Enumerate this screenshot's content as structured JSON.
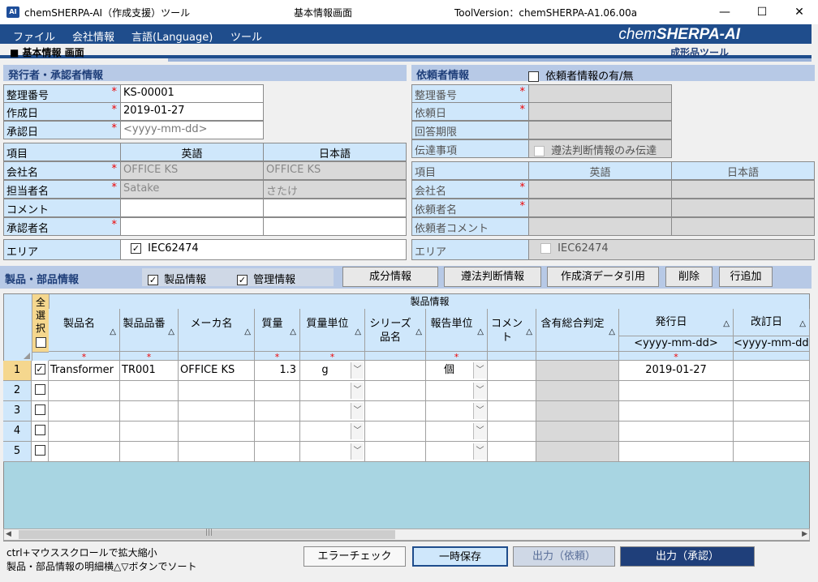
{
  "window": {
    "title": "chemSHERPA-AI（作成支援）ツール",
    "screen_title": "基本情報画面",
    "tool_version": "ToolVersion：chemSHERPA-A1.06.00a",
    "app_icon": "AI"
  },
  "menu": {
    "items": [
      "ファイル",
      "会社情報",
      "言語(Language)",
      "ツール"
    ],
    "logo_prefix": "chem",
    "logo_main": "SHERPA",
    "logo_suffix": "-AI"
  },
  "screen_header": {
    "label": "■ 基本情報 画面",
    "product_tool": "成形品ツール"
  },
  "issuer": {
    "section_title": "発行者・承認者情報",
    "rows": [
      {
        "label": "整理番号",
        "value": "KS-00001"
      },
      {
        "label": "作成日",
        "value": "2019-01-27"
      },
      {
        "label": "承認日",
        "value": "<yyyy-mm-dd>"
      }
    ],
    "table_header": {
      "item": "項目",
      "english": "英語",
      "japanese": "日本語"
    },
    "table_rows": [
      {
        "label": "会社名",
        "required": true,
        "english": "OFFICE KS",
        "japanese": "OFFICE KS"
      },
      {
        "label": "担当者名",
        "required": true,
        "english": "Satake",
        "japanese": "さたけ"
      },
      {
        "label": "コメント",
        "required": false,
        "english": "",
        "japanese": ""
      },
      {
        "label": "承認者名",
        "required": true,
        "english": "",
        "japanese": ""
      }
    ],
    "area_label": "エリア",
    "area_value": "IEC62474",
    "required_mark": "*",
    "check_mark": "✓"
  },
  "requester": {
    "section_title": "依頼者情報",
    "toggle_label": "依頼者情報の有/無",
    "rows": [
      {
        "label": "整理番号",
        "required": true
      },
      {
        "label": "依頼日",
        "required": true
      },
      {
        "label": "回答期限",
        "required": false
      }
    ],
    "transmit_label": "伝達事項",
    "transmit_check": "遵法判断情報のみ伝達",
    "table_header": {
      "item": "項目",
      "english": "英語",
      "japanese": "日本語"
    },
    "table_rows": [
      {
        "label": "会社名",
        "required": true
      },
      {
        "label": "依頼者名",
        "required": true
      },
      {
        "label": "依頼者コメント",
        "required": false
      }
    ],
    "area_label": "エリア",
    "area_value": "IEC62474"
  },
  "parts": {
    "section_title": "製品・部品情報",
    "check_product": "製品情報",
    "check_management": "管理情報",
    "buttons": [
      "成分情報",
      "遵法判断情報",
      "作成済データ引用",
      "削除",
      "行追加"
    ]
  },
  "grid": {
    "group_header": "製品情報",
    "select_all": "全選択",
    "columns": [
      "製品名",
      "製品品番",
      "メーカ名",
      "質量",
      "質量単位",
      "シリーズ品名",
      "報告単位",
      "コメント",
      "含有総合判定",
      "発行日",
      "改訂日"
    ],
    "date_placeholder": "<yyyy-mm-dd>",
    "rows": [
      {
        "num": "1",
        "checked": true,
        "name": "Transformer",
        "part_no": "TR001",
        "maker": "OFFICE KS",
        "mass": "1.3",
        "unit": "g",
        "series": "",
        "report_unit": "個",
        "comment": "",
        "issue_date": "2019-01-27"
      },
      {
        "num": "2",
        "checked": false,
        "name": "",
        "part_no": "",
        "maker": "",
        "mass": "",
        "unit": "",
        "series": "",
        "report_unit": "",
        "comment": "",
        "issue_date": ""
      },
      {
        "num": "3",
        "checked": false,
        "name": "",
        "part_no": "",
        "maker": "",
        "mass": "",
        "unit": "",
        "series": "",
        "report_unit": "",
        "comment": "",
        "issue_date": ""
      },
      {
        "num": "4",
        "checked": false,
        "name": "",
        "part_no": "",
        "maker": "",
        "mass": "",
        "unit": "",
        "series": "",
        "report_unit": "",
        "comment": "",
        "issue_date": ""
      },
      {
        "num": "5",
        "checked": false,
        "name": "",
        "part_no": "",
        "maker": "",
        "mass": "",
        "unit": "",
        "series": "",
        "report_unit": "",
        "comment": "",
        "issue_date": ""
      }
    ]
  },
  "footer": {
    "hint1": "ctrl+マウススクロールで拡大縮小",
    "hint2": "製品・部品情報の明細横△▽ボタンでソート",
    "error_check": "エラーチェック",
    "temp_save": "一時保存",
    "output_request": "出力（依頼）",
    "output_approve": "出力（承認）"
  },
  "colors": {
    "menu_bg": "#1f4d8c",
    "label_bg": "#cfe7fb",
    "grid_bg": "#a8d5e2",
    "required": "#e00000"
  },
  "icons": [
    "minimize-icon",
    "maximize-icon",
    "close-icon",
    "sort-icon",
    "chevron-down-icon",
    "scroll-left-icon",
    "scroll-right-icon"
  ]
}
